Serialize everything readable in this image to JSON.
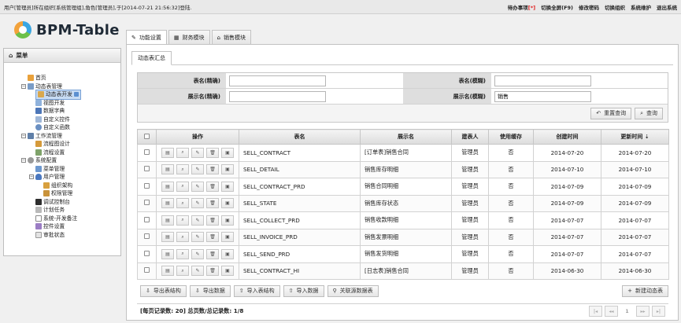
{
  "topbar": {
    "login_info": "用户[管理员]所在组织[系统管理组],角色[管理员],于[2014-07-21 21:56:32]登陆.",
    "todo_label": "待办事项",
    "todo_flag": "[*]",
    "fullscreen": "切换全屏(F9)",
    "change_password": "修改密码",
    "switch_org": "切换组织",
    "maintenance": "系统维护",
    "logout": "退出系统"
  },
  "logo": {
    "text": "BPM-Table"
  },
  "menu": {
    "title": "菜单",
    "items": [
      {
        "label": "首页",
        "icon": "home-icon"
      },
      {
        "label": "动态表管理",
        "icon": "folder-icon"
      },
      {
        "label": "动态表开发",
        "icon": "table-icon"
      },
      {
        "label": "视图开发",
        "icon": "view-icon"
      },
      {
        "label": "数据字典",
        "icon": "dictionary-icon"
      },
      {
        "label": "自定义控件",
        "icon": "control-icon"
      },
      {
        "label": "自定义函数",
        "icon": "function-icon"
      },
      {
        "label": "工作流管理",
        "icon": "workflow-icon"
      },
      {
        "label": "流程图设计",
        "icon": "flow-design-icon"
      },
      {
        "label": "流程设置",
        "icon": "flow-settings-icon"
      },
      {
        "label": "系统配置",
        "icon": "gear-icon"
      },
      {
        "label": "菜单管理",
        "icon": "menu-icon"
      },
      {
        "label": "用户管理",
        "icon": "user-icon"
      },
      {
        "label": "组织架构",
        "icon": "org-icon"
      },
      {
        "label": "权限管理",
        "icon": "permission-icon"
      },
      {
        "label": "调试控制台",
        "icon": "console-icon"
      },
      {
        "label": "计划任务",
        "icon": "schedule-icon"
      },
      {
        "label": "系统-开发备注",
        "icon": "note-icon"
      },
      {
        "label": "控件设置",
        "icon": "settings-icon"
      },
      {
        "label": "审批状态",
        "icon": "approval-icon"
      }
    ]
  },
  "tabs": [
    {
      "label": "功能设置"
    },
    {
      "label": "财务模块"
    },
    {
      "label": "销售模块"
    }
  ],
  "subtab": {
    "label": "动态表汇总"
  },
  "search": {
    "table_name_exact_label": "表名(精确)",
    "table_name_exact_value": "",
    "table_name_fuzzy_label": "表名(模糊)",
    "table_name_fuzzy_value": "",
    "display_name_exact_label": "展示名(精确)",
    "display_name_exact_value": "",
    "display_name_fuzzy_label": "展示名(模糊)",
    "display_name_fuzzy_value": "销售",
    "reset_label": "重置查询",
    "query_label": "查询"
  },
  "grid": {
    "headers": {
      "ops": "操作",
      "table_name": "表名",
      "display_name": "展示名",
      "creator": "建表人",
      "cache": "使用缓存",
      "created": "创建时间",
      "updated": "更新时间 ⇣"
    },
    "rows": [
      {
        "table_name": "SELL_CONTRACT",
        "display_name": "[订单表]销售合同",
        "creator": "管理员",
        "cache": "否",
        "created": "2014-07-20",
        "updated": "2014-07-20"
      },
      {
        "table_name": "SELL_DETAIL",
        "display_name": "销售库存明细",
        "creator": "管理员",
        "cache": "否",
        "created": "2014-07-10",
        "updated": "2014-07-10"
      },
      {
        "table_name": "SELL_CONTRACT_PRD",
        "display_name": "销售合同明细",
        "creator": "管理员",
        "cache": "否",
        "created": "2014-07-09",
        "updated": "2014-07-09"
      },
      {
        "table_name": "SELL_STATE",
        "display_name": "销售库存状态",
        "creator": "管理员",
        "cache": "否",
        "created": "2014-07-09",
        "updated": "2014-07-09"
      },
      {
        "table_name": "SELL_COLLECT_PRD",
        "display_name": "销售收款明细",
        "creator": "管理员",
        "cache": "否",
        "created": "2014-07-07",
        "updated": "2014-07-07"
      },
      {
        "table_name": "SELL_INVOICE_PRD",
        "display_name": "销售发票明细",
        "creator": "管理员",
        "cache": "否",
        "created": "2014-07-07",
        "updated": "2014-07-07"
      },
      {
        "table_name": "SELL_SEND_PRD",
        "display_name": "销售发货明细",
        "creator": "管理员",
        "cache": "否",
        "created": "2014-07-07",
        "updated": "2014-07-07"
      },
      {
        "table_name": "SELL_CONTRACT_HI",
        "display_name": "[日志表]销售合同",
        "creator": "管理员",
        "cache": "否",
        "created": "2014-06-30",
        "updated": "2014-06-30"
      }
    ]
  },
  "toolbar": {
    "export_structure": "导出表结构",
    "export_data": "导出数据",
    "import_structure": "导入表结构",
    "import_data": "导入数据",
    "related_source": "关联源数据表",
    "new_table": "新建动态表"
  },
  "pager": {
    "summary": "[每页记录数: 20] 总页数/总记录数: 1/8",
    "current_page": "1"
  }
}
